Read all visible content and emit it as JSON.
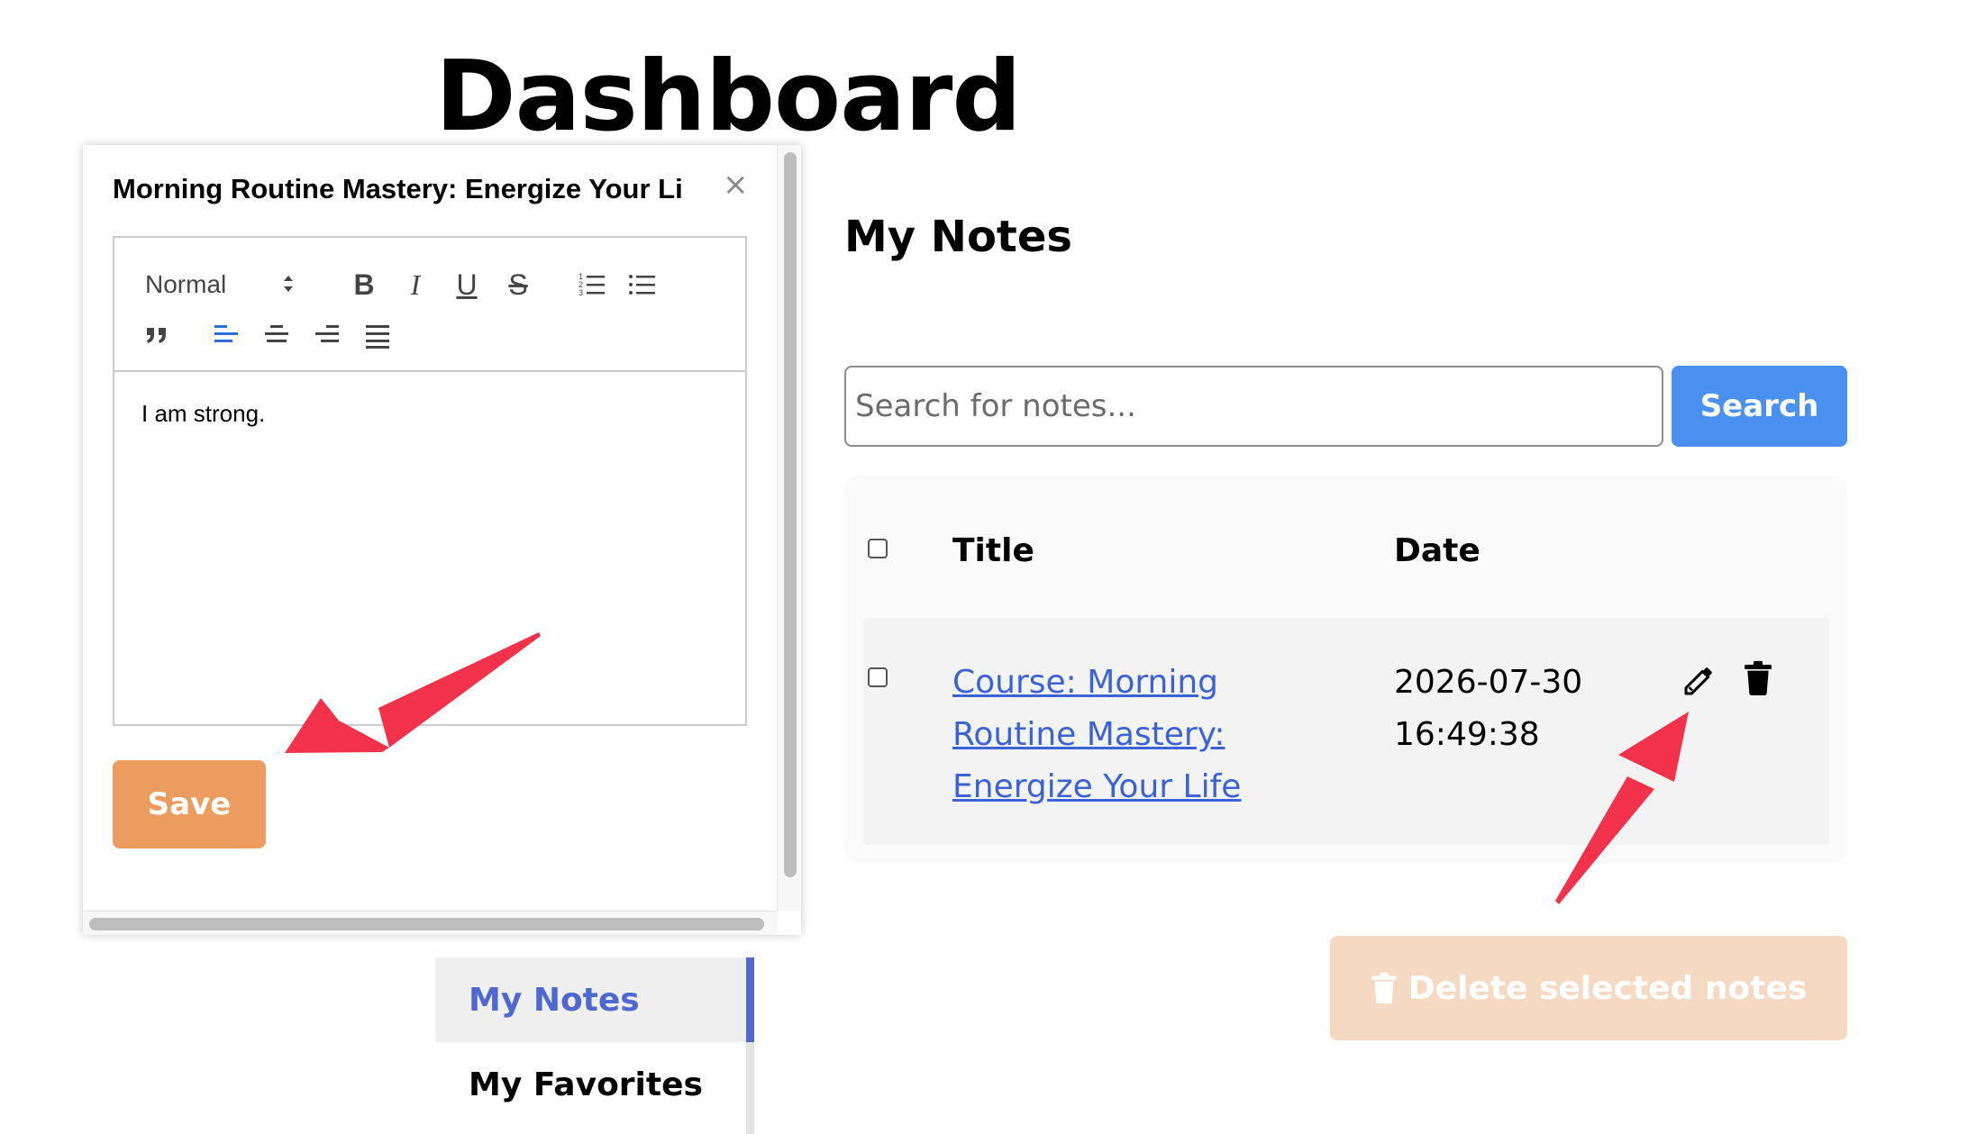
{
  "page": {
    "title": "Dashboard"
  },
  "sidebar": {
    "items": [
      {
        "label": "My Notes",
        "active": true
      },
      {
        "label": "My Favorites",
        "active": false
      }
    ]
  },
  "notes": {
    "section_title": "My Notes",
    "search": {
      "placeholder": "Search for notes...",
      "value": "",
      "button_label": "Search"
    },
    "table": {
      "columns": [
        "Title",
        "Date"
      ],
      "rows": [
        {
          "title": "Course: Morning Routine Mastery: Energize Your Life",
          "date": "2026-07-30 16:49:38"
        }
      ]
    },
    "delete_selected_label": "Delete selected notes"
  },
  "editor_modal": {
    "title": "Morning Routine Mastery: Energize Your Li",
    "close_symbol": "×",
    "toolbar": {
      "format_value": "Normal",
      "buttons": [
        "B",
        "I",
        "U",
        "S"
      ]
    },
    "content": "I am strong.",
    "save_label": "Save"
  },
  "colors": {
    "accent_blue": "#4a90f0",
    "link_blue": "#3b62d6",
    "sidebar_active": "#4e68cf",
    "save_orange": "#ec9c5e",
    "delete_disabled": "#f6d9c3",
    "annotation_red": "#f2314b"
  },
  "icons": {
    "edit": "pencil-icon",
    "delete": "trash-icon",
    "close": "close-icon"
  }
}
